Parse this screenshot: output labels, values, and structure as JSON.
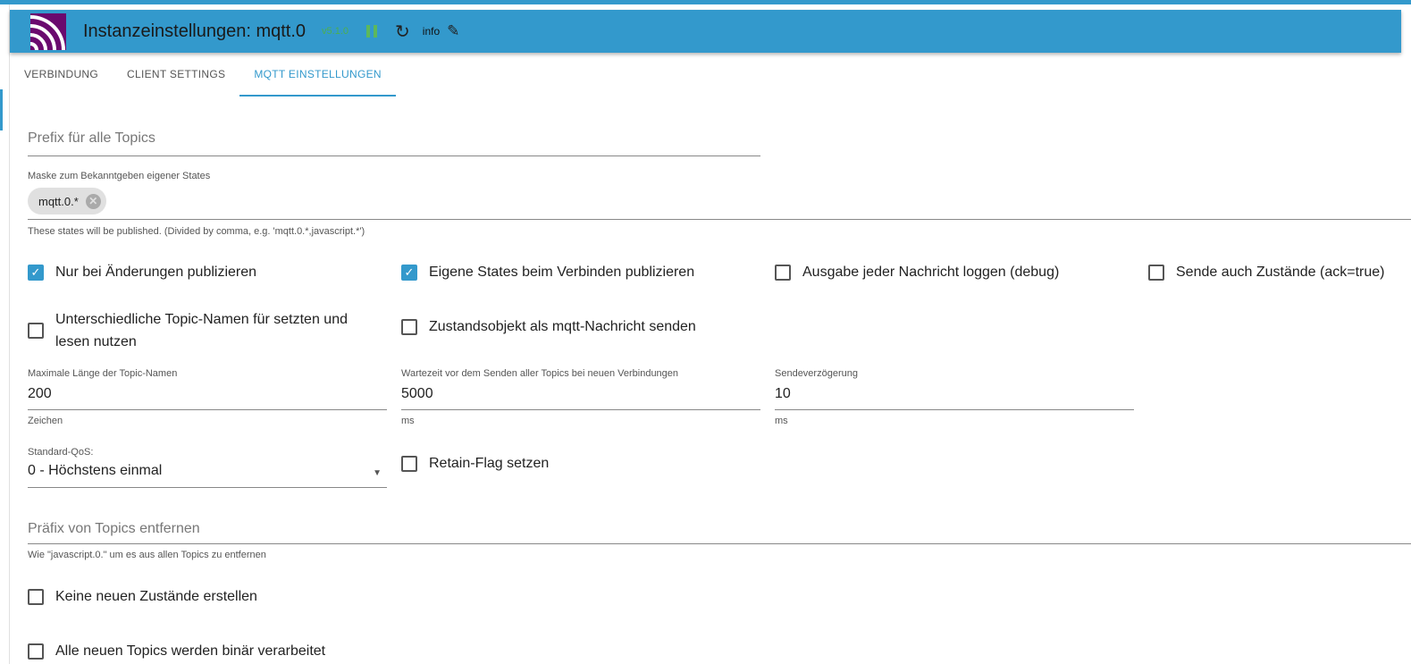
{
  "header": {
    "title": "Instanzeinstellungen: mqtt.0",
    "version": "v5.1.0",
    "info": "info",
    "icons": [
      "mqtt-logo",
      "pause-icon",
      "reload-icon",
      "pencil-icon"
    ]
  },
  "tabs": [
    {
      "label": "Verbindung"
    },
    {
      "label": "Client settings"
    },
    {
      "label": "MQTT Einstellungen",
      "active": true
    }
  ],
  "form": {
    "prefix": {
      "placeholder": "Prefix für alle Topics"
    },
    "mask": {
      "label": "Maske zum Bekanntgeben eigener States",
      "chip": "mqtt.0.*",
      "helper": "These states will be published. (Divided by comma, e.g. 'mqtt.0.*,javascript.*')"
    },
    "checkboxes": [
      {
        "label": "Nur bei Änderungen publizieren",
        "checked": true
      },
      {
        "label": "Eigene States beim Verbinden publizieren",
        "checked": true
      },
      {
        "label": "Ausgabe jeder Nachricht loggen (debug)",
        "checked": false
      },
      {
        "label": "Sende auch Zustände (ack=true)",
        "checked": false
      },
      {
        "label": "Unterschiedliche Topic-Namen für setzten und lesen nutzen",
        "checked": false
      },
      {
        "label": "Zustandsobjekt als mqtt-Nachricht senden",
        "checked": false
      },
      {
        "label": "Retain-Flag setzen",
        "checked": false
      },
      {
        "label": "Keine neuen Zustände erstellen",
        "checked": false
      },
      {
        "label": "Alle neuen Topics werden binär verarbeitet",
        "checked": false
      }
    ],
    "maxlen": {
      "label": "Maximale Länge der Topic-Namen",
      "value": "200",
      "helper": "Zeichen"
    },
    "wait": {
      "label": "Wartezeit vor dem Senden aller Topics bei neuen Verbindungen",
      "value": "5000",
      "helper": "ms"
    },
    "delay": {
      "label": "Sendeverzögerung",
      "value": "10",
      "helper": "ms"
    },
    "qos": {
      "label": "Standard-QoS:",
      "value": "0 - Höchstens einmal"
    },
    "removePrefix": {
      "placeholder": "Präfix von Topics entfernen",
      "helper": "Wie \"javascript.0.\" um es aus allen Topics zu entfernen"
    }
  },
  "colors": {
    "accent": "#3399cc",
    "version": "#4caf50"
  }
}
